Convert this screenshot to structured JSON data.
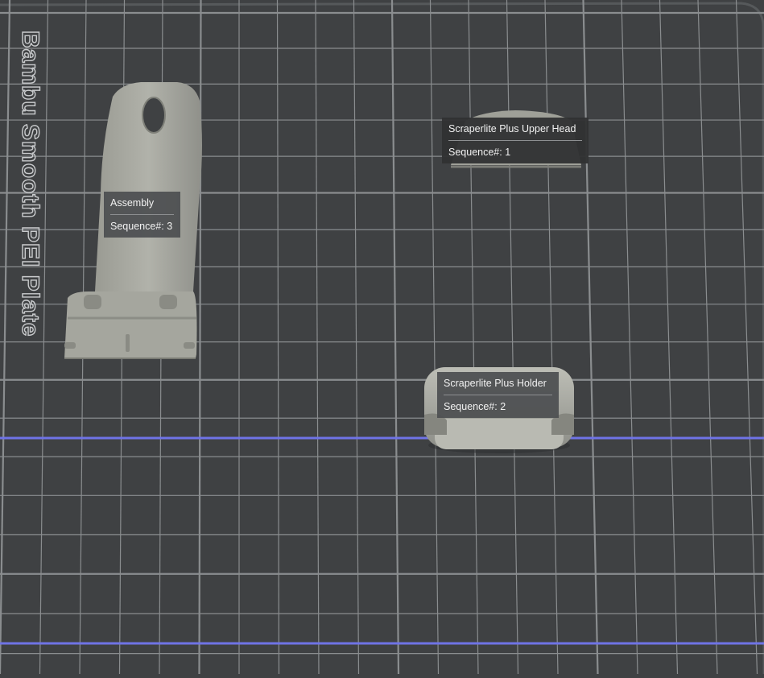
{
  "plate": {
    "name": "Bambu Smooth PEI Plate"
  },
  "objects": [
    {
      "name": "Scraperlite Plus Upper Head",
      "sequence": "Sequence#: 1"
    },
    {
      "name": "Scraperlite Plus Holder",
      "sequence": "Sequence#: 2"
    },
    {
      "name": "Assembly",
      "sequence": "Sequence#: 3"
    }
  ],
  "colors": {
    "bed": "#3f4143",
    "grid": "#8a8d8f",
    "boundary_line": "#6f73e6",
    "model": "#a4a59d"
  }
}
